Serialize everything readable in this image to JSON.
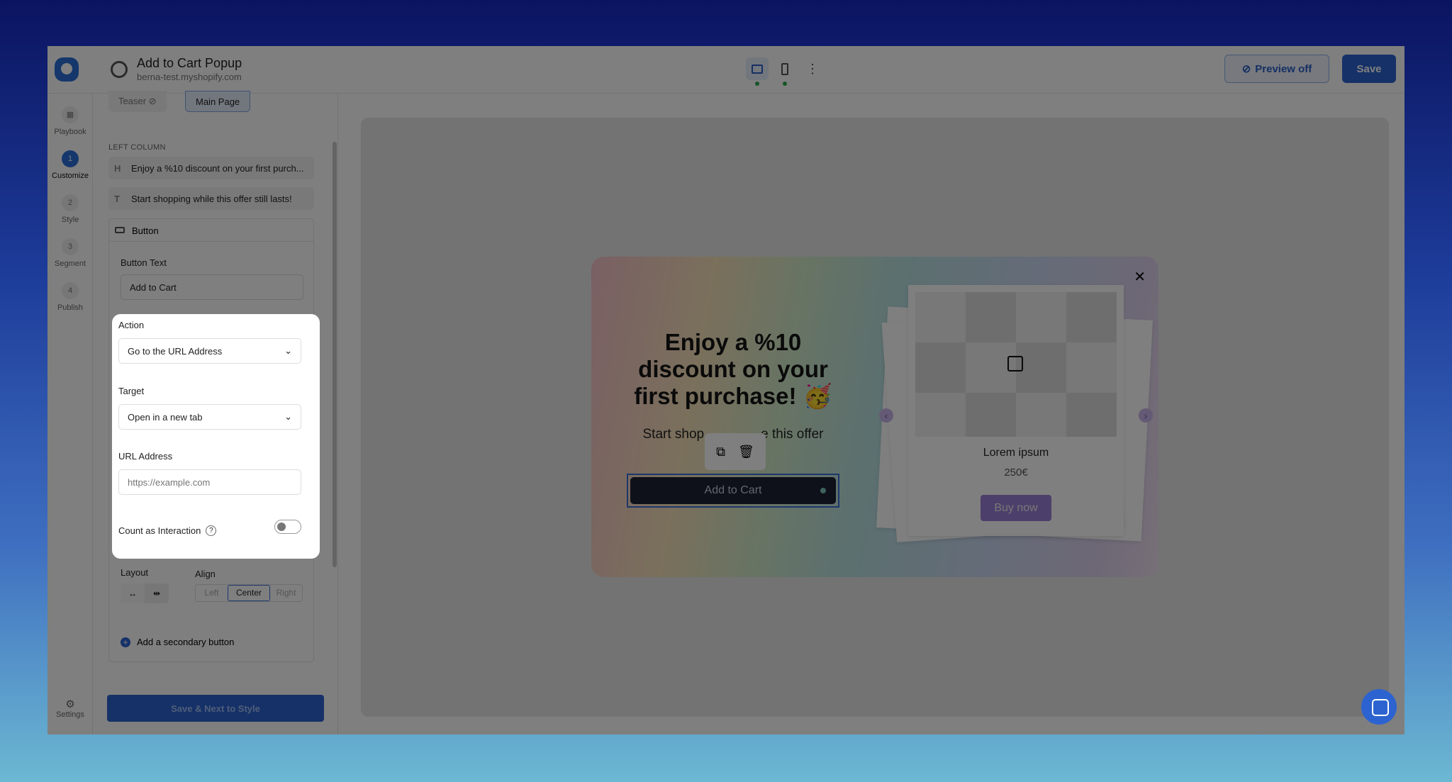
{
  "header": {
    "title": "Add to Cart Popup",
    "subtitle": "berna-test.myshopify.com",
    "preview_label": "Preview off",
    "save_label": "Save"
  },
  "rail": {
    "items": [
      {
        "num": "",
        "label": "Playbook"
      },
      {
        "num": "1",
        "label": "Customize"
      },
      {
        "num": "2",
        "label": "Style"
      },
      {
        "num": "3",
        "label": "Segment"
      },
      {
        "num": "4",
        "label": "Publish"
      }
    ],
    "settings": "Settings"
  },
  "panel": {
    "tabs": [
      "Teaser",
      "Main Page"
    ],
    "section": "LEFT COLUMN",
    "elements": [
      {
        "icon": "H",
        "text": "Enjoy a %10 discount on your first purch..."
      },
      {
        "icon": "T",
        "text": "Start shopping while this offer still lasts!"
      }
    ],
    "button_section": "Button",
    "button_text_label": "Button Text",
    "button_text_value": "Add to Cart",
    "action_label": "Action",
    "action_value": "Go to the URL Address",
    "target_label": "Target",
    "target_value": "Open in a new tab",
    "url_label": "URL Address",
    "url_placeholder": "https://example.com",
    "interaction_label": "Count as Interaction",
    "interaction_on": false,
    "layout_label": "Layout",
    "align_label": "Align",
    "align_options": [
      "Left",
      "Center",
      "Right"
    ],
    "align_selected": "Center",
    "secondary": "Add a secondary button",
    "save_next": "Save & Next to Style"
  },
  "popup": {
    "heading": "Enjoy a %10 discount on your first purchase! 🥳",
    "subtext_visible": "Start shop",
    "subtext_end": "e this offer",
    "button": "Add to Cart",
    "product_name": "Lorem ipsum",
    "product_price": "250€",
    "buy": "Buy now"
  },
  "colors": {
    "primary": "#2c63d0",
    "buy_button": "#9b7fd6",
    "cta": "#1c2233"
  }
}
